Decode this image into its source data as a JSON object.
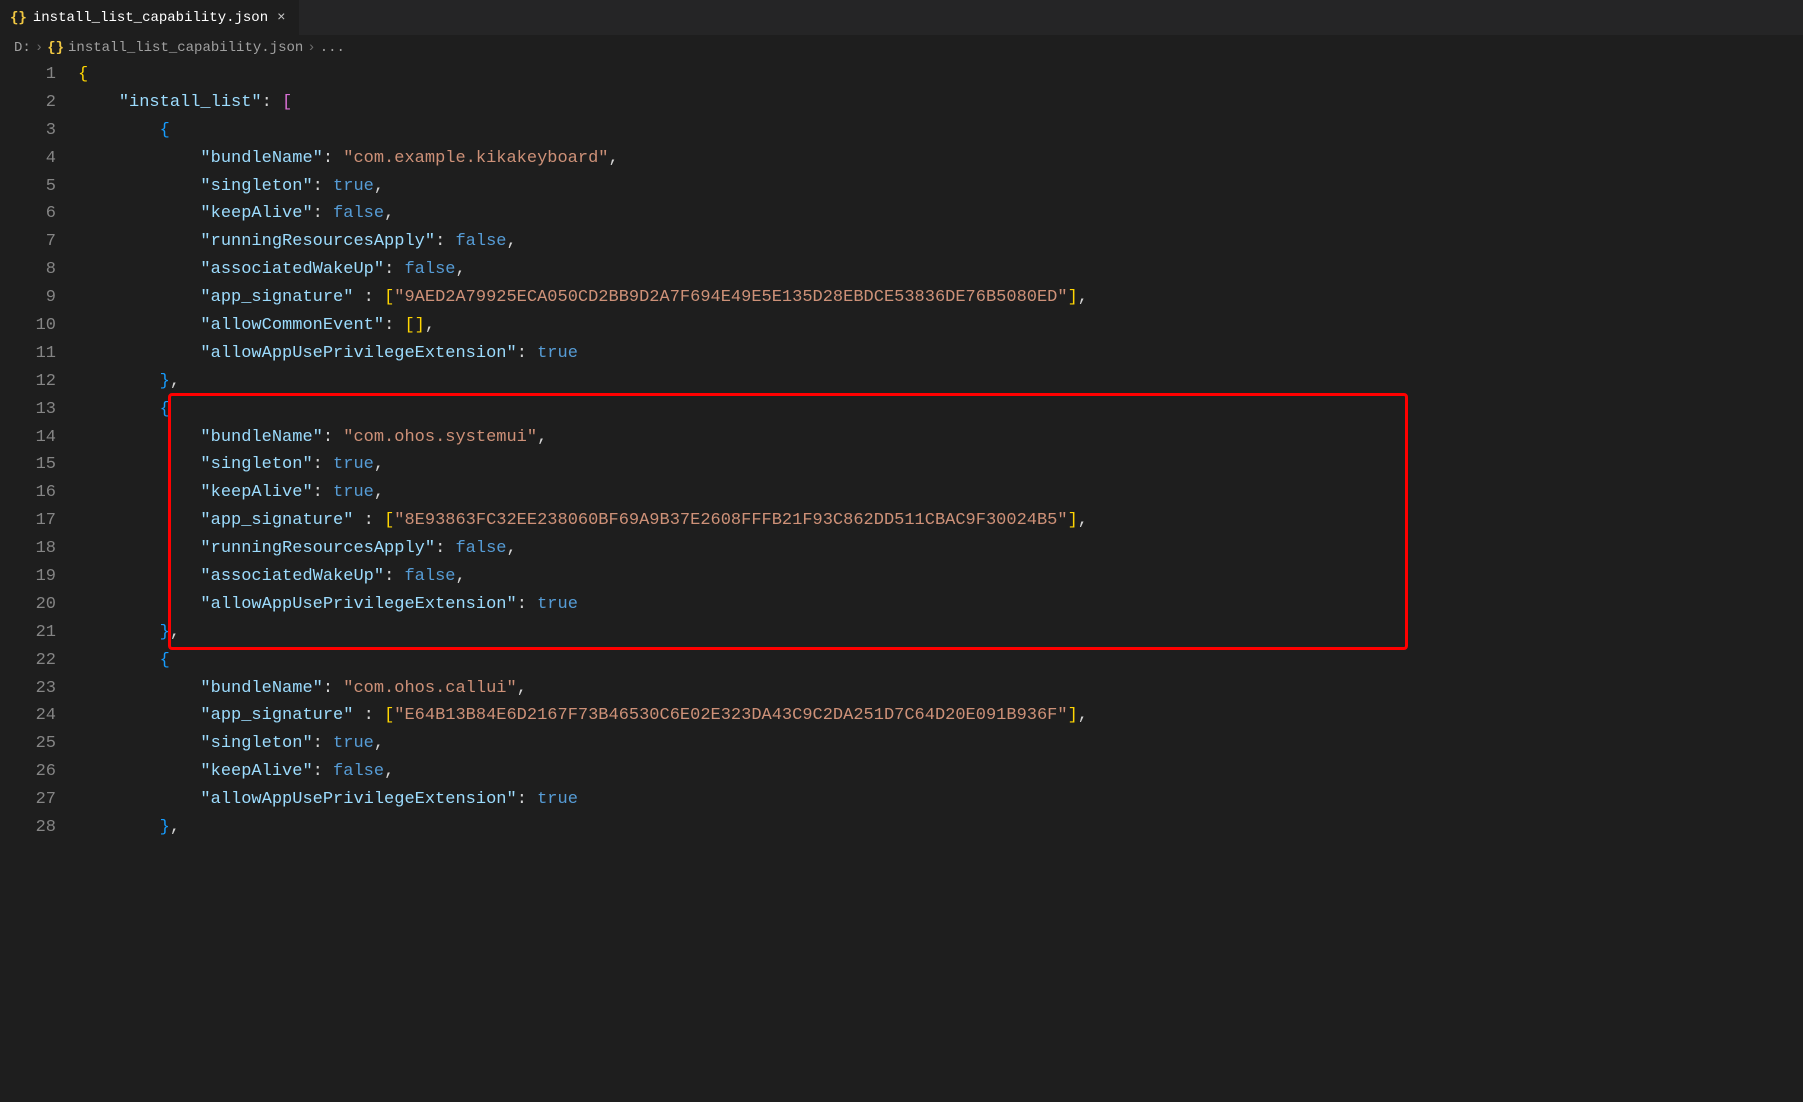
{
  "tab": {
    "icon": "{}",
    "title": "install_list_capability.json",
    "close": "×"
  },
  "breadcrumb": {
    "drive": "D:",
    "sep": "›",
    "icon": "{}",
    "file": "install_list_capability.json",
    "ellipsis": "..."
  },
  "lines": [
    {
      "n": 1,
      "segs": [
        {
          "t": "{",
          "c": "tok-brack"
        }
      ]
    },
    {
      "n": 2,
      "segs": [
        {
          "t": "    ",
          "c": ""
        },
        {
          "t": "\"install_list\"",
          "c": "tok-key"
        },
        {
          "t": ": ",
          "c": "tok-punct"
        },
        {
          "t": "[",
          "c": "tok-brack-p"
        }
      ]
    },
    {
      "n": 3,
      "segs": [
        {
          "t": "        ",
          "c": ""
        },
        {
          "t": "{",
          "c": "tok-brack-b"
        }
      ]
    },
    {
      "n": 4,
      "segs": [
        {
          "t": "            ",
          "c": ""
        },
        {
          "t": "\"bundleName\"",
          "c": "tok-key"
        },
        {
          "t": ": ",
          "c": "tok-punct"
        },
        {
          "t": "\"com.example.kikakeyboard\"",
          "c": "tok-str"
        },
        {
          "t": ",",
          "c": "tok-punct"
        }
      ]
    },
    {
      "n": 5,
      "segs": [
        {
          "t": "            ",
          "c": ""
        },
        {
          "t": "\"singleton\"",
          "c": "tok-key"
        },
        {
          "t": ": ",
          "c": "tok-punct"
        },
        {
          "t": "true",
          "c": "tok-bool"
        },
        {
          "t": ",",
          "c": "tok-punct"
        }
      ]
    },
    {
      "n": 6,
      "segs": [
        {
          "t": "            ",
          "c": ""
        },
        {
          "t": "\"keepAlive\"",
          "c": "tok-key"
        },
        {
          "t": ": ",
          "c": "tok-punct"
        },
        {
          "t": "false",
          "c": "tok-bool"
        },
        {
          "t": ",",
          "c": "tok-punct"
        }
      ]
    },
    {
      "n": 7,
      "segs": [
        {
          "t": "            ",
          "c": ""
        },
        {
          "t": "\"runningResourcesApply\"",
          "c": "tok-key"
        },
        {
          "t": ": ",
          "c": "tok-punct"
        },
        {
          "t": "false",
          "c": "tok-bool"
        },
        {
          "t": ",",
          "c": "tok-punct"
        }
      ]
    },
    {
      "n": 8,
      "segs": [
        {
          "t": "            ",
          "c": ""
        },
        {
          "t": "\"associatedWakeUp\"",
          "c": "tok-key"
        },
        {
          "t": ": ",
          "c": "tok-punct"
        },
        {
          "t": "false",
          "c": "tok-bool"
        },
        {
          "t": ",",
          "c": "tok-punct"
        }
      ]
    },
    {
      "n": 9,
      "segs": [
        {
          "t": "            ",
          "c": ""
        },
        {
          "t": "\"app_signature\"",
          "c": "tok-key"
        },
        {
          "t": " : ",
          "c": "tok-punct"
        },
        {
          "t": "[",
          "c": "tok-brack"
        },
        {
          "t": "\"9AED2A79925ECA050CD2BB9D2A7F694E49E5E135D28EBDCE53836DE76B5080ED\"",
          "c": "tok-str"
        },
        {
          "t": "]",
          "c": "tok-brack"
        },
        {
          "t": ",",
          "c": "tok-punct"
        }
      ]
    },
    {
      "n": 10,
      "segs": [
        {
          "t": "            ",
          "c": ""
        },
        {
          "t": "\"allowCommonEvent\"",
          "c": "tok-key"
        },
        {
          "t": ": ",
          "c": "tok-punct"
        },
        {
          "t": "[",
          "c": "tok-brack"
        },
        {
          "t": "]",
          "c": "tok-brack"
        },
        {
          "t": ",",
          "c": "tok-punct"
        }
      ]
    },
    {
      "n": 11,
      "segs": [
        {
          "t": "            ",
          "c": ""
        },
        {
          "t": "\"allowAppUsePrivilegeExtension\"",
          "c": "tok-key"
        },
        {
          "t": ": ",
          "c": "tok-punct"
        },
        {
          "t": "true",
          "c": "tok-bool"
        }
      ]
    },
    {
      "n": 12,
      "segs": [
        {
          "t": "        ",
          "c": ""
        },
        {
          "t": "}",
          "c": "tok-brack-b"
        },
        {
          "t": ",",
          "c": "tok-punct"
        }
      ]
    },
    {
      "n": 13,
      "segs": [
        {
          "t": "        ",
          "c": ""
        },
        {
          "t": "{",
          "c": "tok-brack-b"
        }
      ]
    },
    {
      "n": 14,
      "segs": [
        {
          "t": "            ",
          "c": ""
        },
        {
          "t": "\"bundleName\"",
          "c": "tok-key"
        },
        {
          "t": ": ",
          "c": "tok-punct"
        },
        {
          "t": "\"com.ohos.systemui\"",
          "c": "tok-str"
        },
        {
          "t": ",",
          "c": "tok-punct"
        }
      ]
    },
    {
      "n": 15,
      "segs": [
        {
          "t": "            ",
          "c": ""
        },
        {
          "t": "\"singleton\"",
          "c": "tok-key"
        },
        {
          "t": ": ",
          "c": "tok-punct"
        },
        {
          "t": "true",
          "c": "tok-bool"
        },
        {
          "t": ",",
          "c": "tok-punct"
        }
      ]
    },
    {
      "n": 16,
      "segs": [
        {
          "t": "            ",
          "c": ""
        },
        {
          "t": "\"keepAlive\"",
          "c": "tok-key"
        },
        {
          "t": ": ",
          "c": "tok-punct"
        },
        {
          "t": "true",
          "c": "tok-bool"
        },
        {
          "t": ",",
          "c": "tok-punct"
        }
      ]
    },
    {
      "n": 17,
      "segs": [
        {
          "t": "            ",
          "c": ""
        },
        {
          "t": "\"app_signature\"",
          "c": "tok-key"
        },
        {
          "t": " : ",
          "c": "tok-punct"
        },
        {
          "t": "[",
          "c": "tok-brack"
        },
        {
          "t": "\"8E93863FC32EE238060BF69A9B37E2608FFFB21F93C862DD511CBAC9F30024B5\"",
          "c": "tok-str"
        },
        {
          "t": "]",
          "c": "tok-brack"
        },
        {
          "t": ",",
          "c": "tok-punct"
        }
      ]
    },
    {
      "n": 18,
      "segs": [
        {
          "t": "            ",
          "c": ""
        },
        {
          "t": "\"runningResourcesApply\"",
          "c": "tok-key"
        },
        {
          "t": ": ",
          "c": "tok-punct"
        },
        {
          "t": "false",
          "c": "tok-bool"
        },
        {
          "t": ",",
          "c": "tok-punct"
        }
      ]
    },
    {
      "n": 19,
      "segs": [
        {
          "t": "            ",
          "c": ""
        },
        {
          "t": "\"associatedWakeUp\"",
          "c": "tok-key"
        },
        {
          "t": ": ",
          "c": "tok-punct"
        },
        {
          "t": "false",
          "c": "tok-bool"
        },
        {
          "t": ",",
          "c": "tok-punct"
        }
      ]
    },
    {
      "n": 20,
      "segs": [
        {
          "t": "            ",
          "c": ""
        },
        {
          "t": "\"allowAppUsePrivilegeExtension\"",
          "c": "tok-key"
        },
        {
          "t": ": ",
          "c": "tok-punct"
        },
        {
          "t": "true",
          "c": "tok-bool"
        }
      ]
    },
    {
      "n": 21,
      "segs": [
        {
          "t": "        ",
          "c": ""
        },
        {
          "t": "}",
          "c": "tok-brack-b"
        },
        {
          "t": ",",
          "c": "tok-punct"
        }
      ]
    },
    {
      "n": 22,
      "segs": [
        {
          "t": "        ",
          "c": ""
        },
        {
          "t": "{",
          "c": "tok-brack-b"
        }
      ]
    },
    {
      "n": 23,
      "segs": [
        {
          "t": "            ",
          "c": ""
        },
        {
          "t": "\"bundleName\"",
          "c": "tok-key"
        },
        {
          "t": ": ",
          "c": "tok-punct"
        },
        {
          "t": "\"com.ohos.callui\"",
          "c": "tok-str"
        },
        {
          "t": ",",
          "c": "tok-punct"
        }
      ]
    },
    {
      "n": 24,
      "segs": [
        {
          "t": "            ",
          "c": ""
        },
        {
          "t": "\"app_signature\"",
          "c": "tok-key"
        },
        {
          "t": " : ",
          "c": "tok-punct"
        },
        {
          "t": "[",
          "c": "tok-brack"
        },
        {
          "t": "\"E64B13B84E6D2167F73B46530C6E02E323DA43C9C2DA251D7C64D20E091B936F\"",
          "c": "tok-str"
        },
        {
          "t": "]",
          "c": "tok-brack"
        },
        {
          "t": ",",
          "c": "tok-punct"
        }
      ]
    },
    {
      "n": 25,
      "segs": [
        {
          "t": "            ",
          "c": ""
        },
        {
          "t": "\"singleton\"",
          "c": "tok-key"
        },
        {
          "t": ": ",
          "c": "tok-punct"
        },
        {
          "t": "true",
          "c": "tok-bool"
        },
        {
          "t": ",",
          "c": "tok-punct"
        }
      ]
    },
    {
      "n": 26,
      "segs": [
        {
          "t": "            ",
          "c": ""
        },
        {
          "t": "\"keepAlive\"",
          "c": "tok-key"
        },
        {
          "t": ": ",
          "c": "tok-punct"
        },
        {
          "t": "false",
          "c": "tok-bool"
        },
        {
          "t": ",",
          "c": "tok-punct"
        }
      ]
    },
    {
      "n": 27,
      "segs": [
        {
          "t": "            ",
          "c": ""
        },
        {
          "t": "\"allowAppUsePrivilegeExtension\"",
          "c": "tok-key"
        },
        {
          "t": ": ",
          "c": "tok-punct"
        },
        {
          "t": "true",
          "c": "tok-bool"
        }
      ]
    },
    {
      "n": 28,
      "segs": [
        {
          "t": "        ",
          "c": ""
        },
        {
          "t": "}",
          "c": "tok-brack-b"
        },
        {
          "t": ",",
          "c": "tok-punct"
        }
      ]
    }
  ],
  "highlight": {
    "startLine": 13,
    "endLine": 21
  }
}
